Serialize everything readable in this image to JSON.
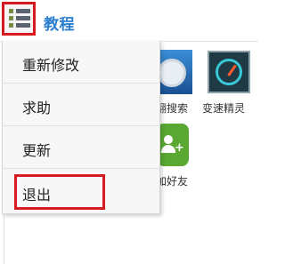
{
  "header": {
    "title": "教程",
    "menu_icon": "list-menu-icon"
  },
  "menu": {
    "items": [
      {
        "label": "重新修改"
      },
      {
        "label": "求助"
      },
      {
        "label": "更新"
      },
      {
        "label": "退出"
      }
    ],
    "highlighted_item": "退出"
  },
  "apps": [
    {
      "label": "翻搜索",
      "icon": "search-app-icon"
    },
    {
      "label": "变速精灵",
      "icon": "speedometer-icon"
    },
    {
      "label": "加好友",
      "icon": "add-friend-icon"
    }
  ],
  "colors": {
    "accent": "#2a7fd0",
    "highlight_border": "#d71920",
    "friend_icon": "#5aa832"
  }
}
